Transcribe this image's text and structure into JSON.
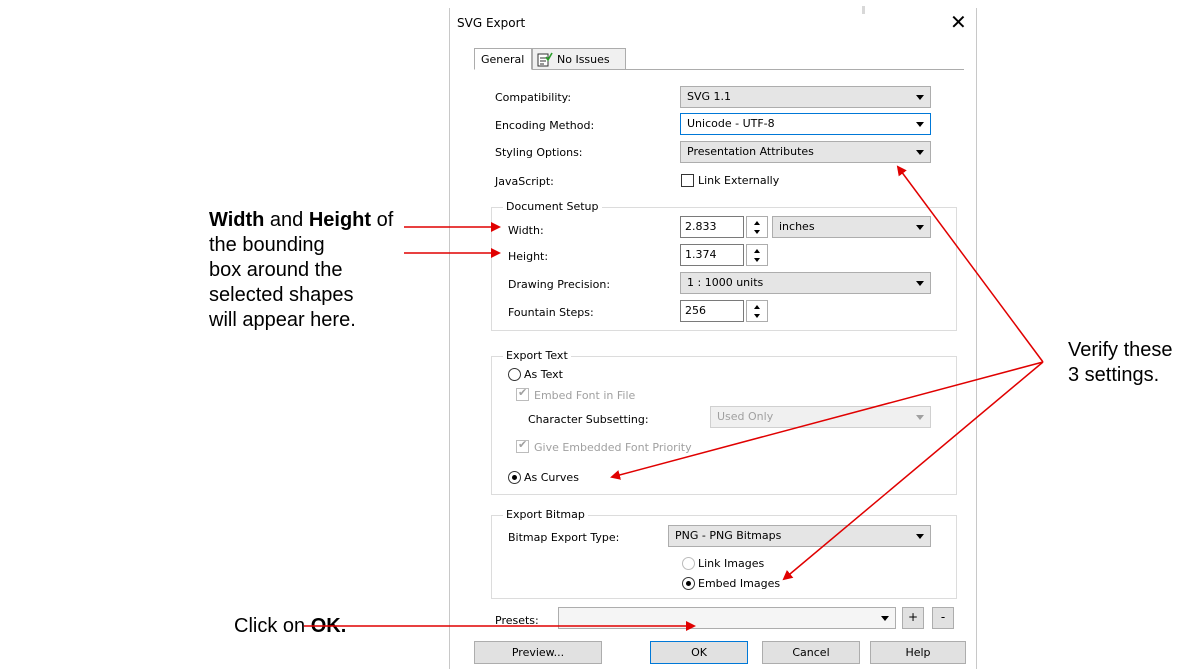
{
  "dialog": {
    "title": "SVG Export",
    "close_glyph": "✕",
    "tabs": [
      {
        "label": "General",
        "active": true
      },
      {
        "label": "No Issues",
        "icon": "checklist-icon"
      }
    ]
  },
  "general": {
    "compatibility": {
      "label": "Compatibility:",
      "value": "SVG 1.1"
    },
    "encoding": {
      "label": "Encoding Method:",
      "value": "Unicode - UTF-8"
    },
    "styling": {
      "label": "Styling Options:",
      "value": "Presentation Attributes"
    },
    "javascript": {
      "label": "JavaScript:",
      "checkbox_label": "Link Externally",
      "checked": false
    }
  },
  "document_setup": {
    "legend": "Document Setup",
    "width": {
      "label": "Width:",
      "value": "2.833"
    },
    "units": "inches",
    "height": {
      "label": "Height:",
      "value": "1.374"
    },
    "precision": {
      "label": "Drawing Precision:",
      "value": "1 : 1000 units"
    },
    "fountain": {
      "label": "Fountain Steps:",
      "value": "256"
    }
  },
  "export_text": {
    "legend": "Export Text",
    "as_text": "As Text",
    "embed_font": "Embed Font in File",
    "subsetting_label": "Character Subsetting:",
    "subsetting_value": "Used Only",
    "give_priority": "Give Embedded Font Priority",
    "as_curves": "As Curves",
    "selected": "As Curves"
  },
  "export_bitmap": {
    "legend": "Export Bitmap",
    "type_label": "Bitmap Export Type:",
    "type_value": "PNG - PNG Bitmaps",
    "link_images": "Link Images",
    "embed_images": "Embed Images",
    "selected": "Embed Images"
  },
  "presets": {
    "label": "Presets:",
    "value": "",
    "add": "+",
    "remove": "-"
  },
  "buttons": {
    "preview": "Preview...",
    "ok": "OK",
    "cancel": "Cancel",
    "help": "Help"
  },
  "annotations": {
    "width_bold": "Width",
    "and": " and ",
    "height_bold": "Height",
    "rest1": " of the bounding",
    "line2": "box around the selected shapes",
    "line3": "will appear here.",
    "verify1": "Verify these",
    "verify2": "3 settings.",
    "click_on": "Click on ",
    "ok_bold": "OK."
  },
  "colors": {
    "arrow": "#e00000",
    "focus_border": "#0078d7"
  }
}
